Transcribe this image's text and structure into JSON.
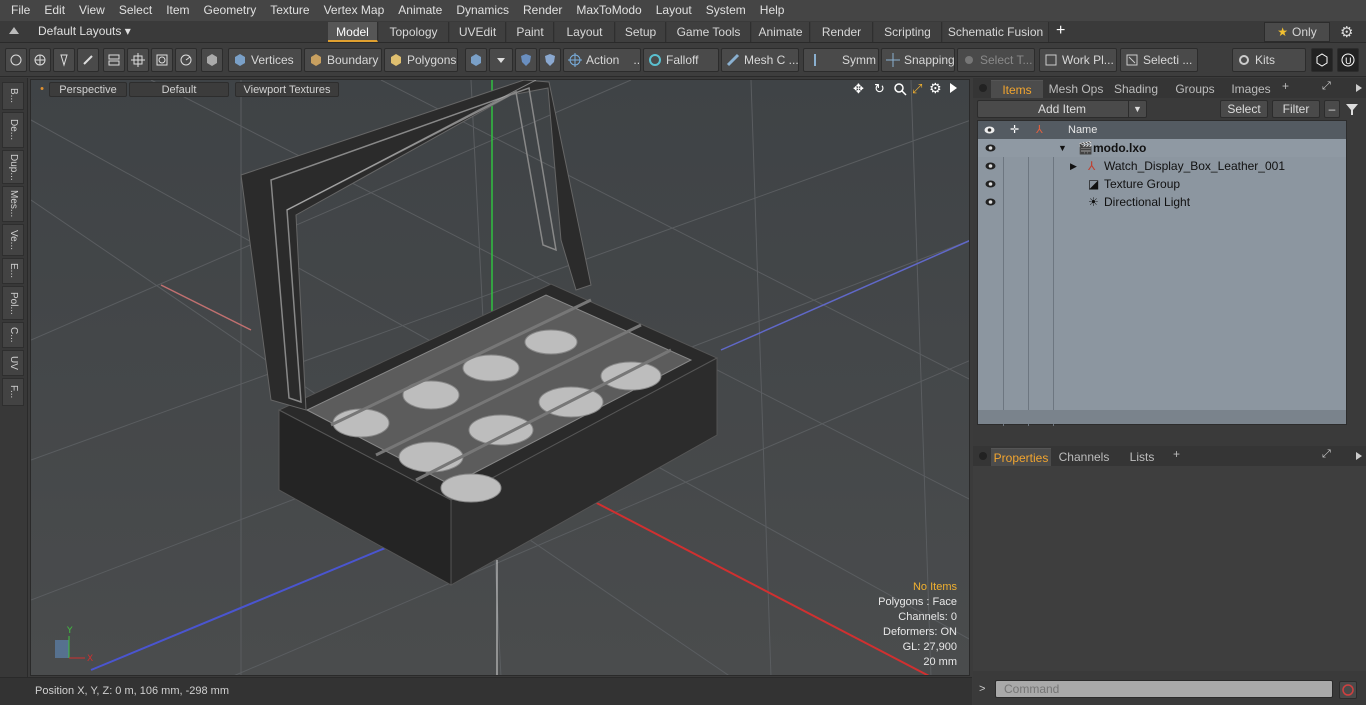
{
  "menu": [
    "File",
    "Edit",
    "View",
    "Select",
    "Item",
    "Geometry",
    "Texture",
    "Vertex Map",
    "Animate",
    "Dynamics",
    "Render",
    "MaxToModo",
    "Layout",
    "System",
    "Help"
  ],
  "layout": {
    "selector": "Default Layouts ▾",
    "tabs": [
      "Model",
      "Topology",
      "UVEdit",
      "Paint",
      "Layout",
      "Setup",
      "Game Tools",
      "Animate",
      "Render",
      "Scripting",
      "Schematic Fusion"
    ],
    "active_tab": "Model",
    "only_label": "Only"
  },
  "toolbar": {
    "vertices": "Vertices",
    "boundary": "Boundary",
    "polygons": "Polygons",
    "action": "Action",
    "falloff": "Falloff",
    "mesh": "Mesh C ...",
    "symm": "Symm ...",
    "snapping": "Snapping",
    "select_t": "Select T...",
    "work_pl": "Work Pl...",
    "selecti": "Selecti ...",
    "kits": "Kits"
  },
  "lefttabs": [
    "B...",
    "De...",
    "Dup...",
    "Mes...",
    "Ve...",
    "E...",
    "Pol...",
    "C...",
    "UV",
    "F..."
  ],
  "viewport": {
    "perspective": "Perspective",
    "default": "Default",
    "textures": "Viewport Textures",
    "stats": {
      "no_items": "No Items",
      "polygons": "Polygons : Face",
      "channels": "Channels: 0",
      "deformers": "Deformers: ON",
      "gl": "GL: 27,900",
      "scale": "20 mm"
    }
  },
  "status": {
    "position": "Position X, Y, Z:   0 m, 106 mm, -298 mm"
  },
  "items_panel": {
    "tabs": [
      "Items",
      "Mesh Ops",
      "Shading",
      "Groups",
      "Images"
    ],
    "add_item": "Add Item",
    "select": "Select",
    "filter": "Filter",
    "col_name": "Name",
    "rows": [
      {
        "label": "modo.lxo"
      },
      {
        "label": "Watch_Display_Box_Leather_001"
      },
      {
        "label": "Texture Group"
      },
      {
        "label": "Directional Light"
      }
    ]
  },
  "props_panel": {
    "tabs": [
      "Properties",
      "Channels",
      "Lists"
    ]
  },
  "command": {
    "placeholder": "Command"
  },
  "colors": {
    "accent": "#f2a52f",
    "tree_bg": "#8c96a0"
  }
}
